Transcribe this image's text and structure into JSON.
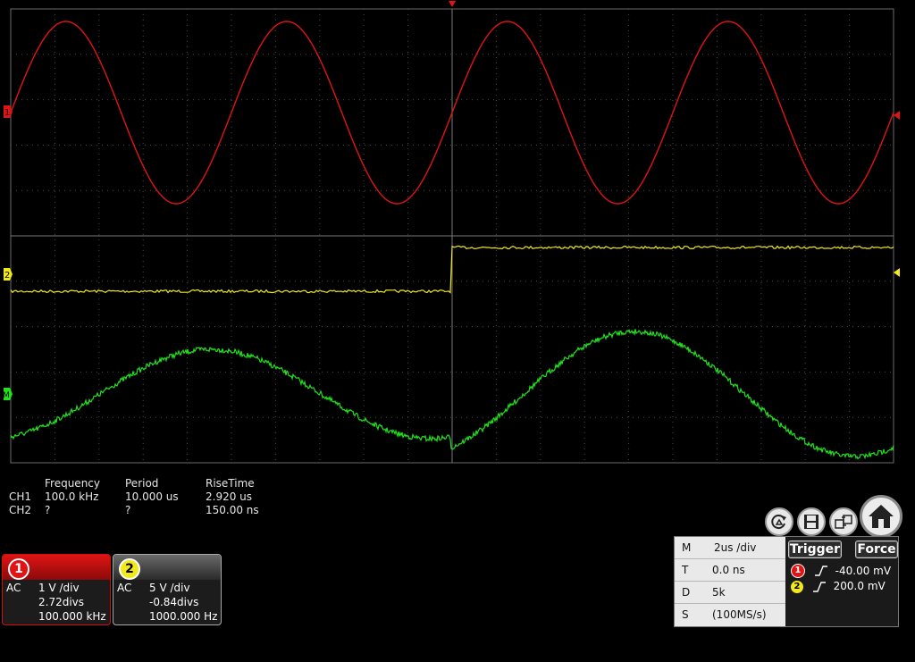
{
  "measurements": {
    "headers": [
      "Frequency",
      "Period",
      "RiseTime"
    ],
    "rows": [
      {
        "ch": "CH1",
        "frequency": "100.0 kHz",
        "period": "10.000 us",
        "risetime": "2.920 us"
      },
      {
        "ch": "CH2",
        "frequency": "?",
        "period": "?",
        "risetime": "150.00 ns"
      }
    ]
  },
  "markers": {
    "ch1": "1",
    "ch2": "2",
    "math": "M"
  },
  "channel1": {
    "badge": "1",
    "coupling": "AC",
    "scale": "1 V /div",
    "offset": "2.72divs",
    "freq": "100.000 kHz",
    "color": "#e01414"
  },
  "channel2": {
    "badge": "2",
    "coupling": "AC",
    "scale": "5 V /div",
    "offset": "-0.84divs",
    "freq": "1000.000 Hz",
    "color": "#f2e91a"
  },
  "timebase": {
    "m_label": "M",
    "m_value": "2us /div",
    "t_label": "T",
    "t_value": "0.0 ns",
    "d_label": "D",
    "d_value": "5k",
    "s_label": "S",
    "s_value": "(100MS/s)"
  },
  "trigger": {
    "trigger_label": "Trigger",
    "force_label": "Force",
    "ch1_badge": "1",
    "ch1_level": "-40.00 mV",
    "ch2_badge": "2",
    "ch2_level": "200.0 mV"
  },
  "toolbar": {
    "icons": [
      "autoset-icon",
      "save-icon",
      "copy-icon",
      "home-icon"
    ]
  },
  "colors": {
    "ch1": "#e01414",
    "ch2": "#f2e91a",
    "math": "#22e01e",
    "grid": "#5a5a5a"
  }
}
